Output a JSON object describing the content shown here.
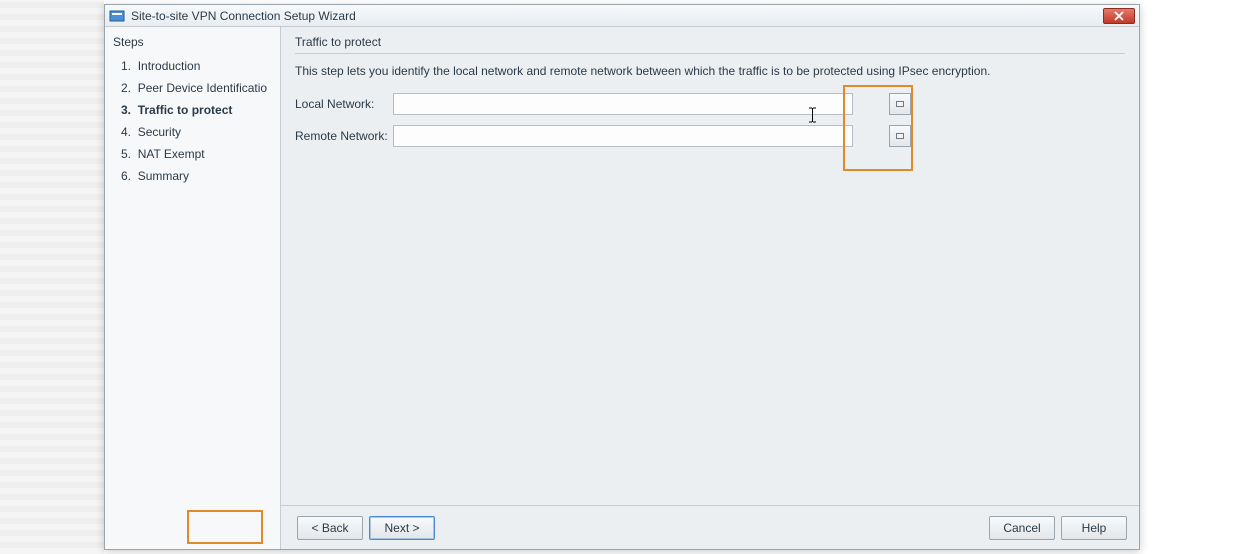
{
  "window": {
    "title": "Site-to-site VPN Connection Setup Wizard"
  },
  "sidebar": {
    "header": "Steps",
    "steps": [
      {
        "num": "1.",
        "label": "Introduction",
        "active": false
      },
      {
        "num": "2.",
        "label": "Peer Device Identificatio",
        "active": false
      },
      {
        "num": "3.",
        "label": "Traffic to protect",
        "active": true
      },
      {
        "num": "4.",
        "label": "Security",
        "active": false
      },
      {
        "num": "5.",
        "label": "NAT Exempt",
        "active": false
      },
      {
        "num": "6.",
        "label": "Summary",
        "active": false
      }
    ]
  },
  "page": {
    "title": "Traffic to protect",
    "description": "This step lets you identify the local network and remote network between which the traffic is to be protected using IPsec encryption."
  },
  "form": {
    "local_label": "Local Network:",
    "local_value": "",
    "remote_label": "Remote Network:",
    "remote_value": ""
  },
  "footer": {
    "back": "< Back",
    "next": "Next >",
    "cancel": "Cancel",
    "help": "Help"
  }
}
